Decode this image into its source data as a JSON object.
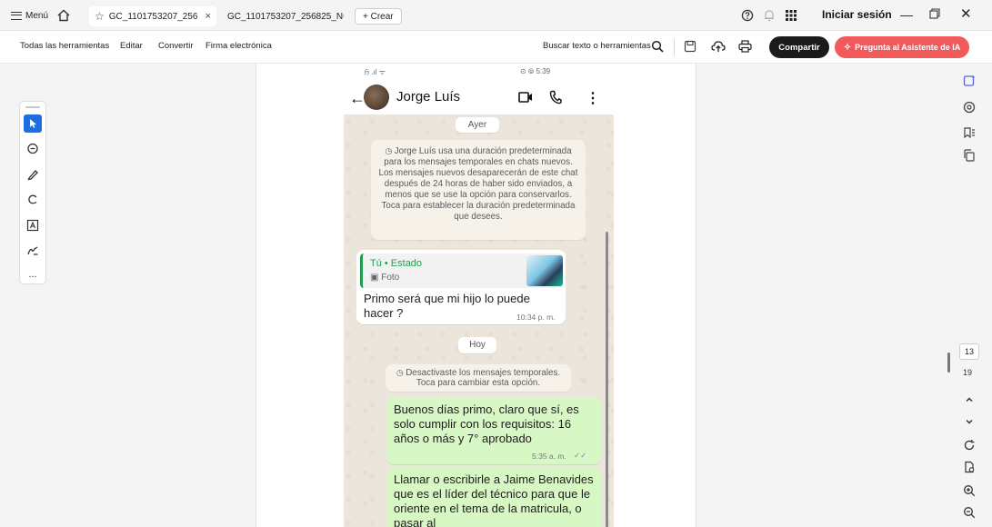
{
  "tabbar": {
    "menu_label": "Menú",
    "tabs": [
      {
        "label": "GC_1101753207_256...",
        "close": "×"
      },
      {
        "label": "GC_1101753207_256825_NO..."
      }
    ],
    "new_tab_label": "+ Crear",
    "login_label": "Iniciar sesión",
    "minimize": "—",
    "close": "✕"
  },
  "toolbar": {
    "items": [
      "Todas las herramientas",
      "Editar",
      "Convertir",
      "Firma electrónica"
    ],
    "search_placeholder": "Buscar texto o herramientas",
    "share_label": "Compartir",
    "ai_label": "Pregunta al Asistente de IA",
    "colors": {
      "share_bg": "#1b1b1b",
      "ai_bg": "#f15a5a",
      "accent": "#1d6fe0"
    }
  },
  "left_rail": {
    "more_label": "..."
  },
  "right_rail": {
    "current_page": "13",
    "total_pages": "19"
  },
  "phone": {
    "status_left": "ℌ .ıl ᯤ",
    "status_right": "⊙ ⦾ 5:39",
    "contact_name": "Jorge Luís",
    "chip_ayer": "Ayer",
    "system_msg_1": "Jorge Luís usa una duración predeterminada para los mensajes temporales en chats nuevos. Los mensajes nuevos desaparecerán de este chat después de 24 horas de haber sido enviados, a menos que se use la opción para conservarlos. Toca para establecer la duración predeterminada que desees.",
    "reply_author": "Tú • Estado",
    "reply_type": "Foto",
    "msg_in_text": "Primo será que mi hijo lo puede hacer ?",
    "msg_in_time": "10:34 p. m.",
    "chip_hoy": "Hoy",
    "system_msg_2": "Desactivaste los mensajes temporales. Toca para cambiar esta opción.",
    "msg_out_1_text": "Buenos días primo, claro que sí, es solo cumplir con los requisitos: 16 años o más y 7° aprobado",
    "msg_out_1_time": "5:35 a. m.",
    "msg_out_2_text": "Llamar o escribirle a Jaime Benavides que es el líder del técnico para que le oriente en el tema de la matricula, o pasar al",
    "colors": {
      "out_bubble": "#d7f8c4",
      "in_bubble": "#ffffff",
      "reply_accent": "#1f9c52"
    }
  }
}
